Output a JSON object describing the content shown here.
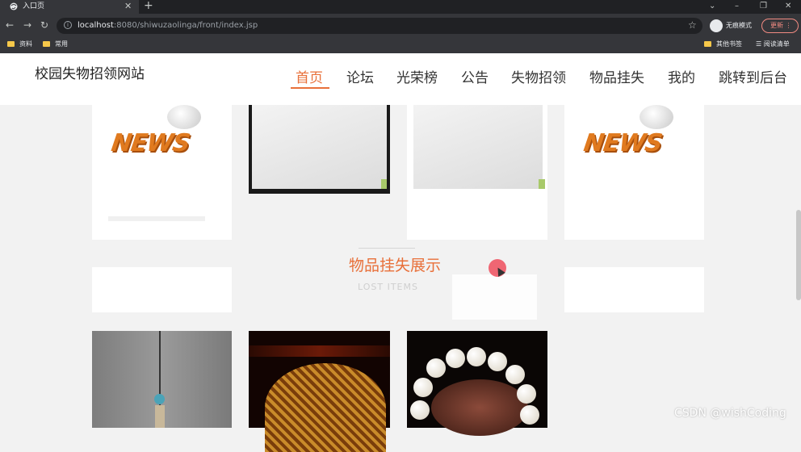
{
  "browser": {
    "tab_title": "入口页",
    "url_host": "localhost",
    "url_rest": ":8080/shiwuzaolinga/front/index.jsp",
    "incognito_label": "无痕模式",
    "update_label": "更新",
    "bookmarks": [
      "资料",
      "常用"
    ],
    "right_bookmarks": [
      "其他书签",
      "阅读清单"
    ]
  },
  "site": {
    "title": "校园失物招领网站",
    "nav": [
      "首页",
      "论坛",
      "光荣榜",
      "公告",
      "失物招领",
      "物品挂失",
      "我的",
      "跳转到后台"
    ],
    "active_nav_index": 0,
    "accent_color": "#e8703a"
  },
  "section": {
    "title": "物品挂失展示",
    "subtitle": "LOST ITEMS"
  },
  "cards_top": [
    {
      "image": "news-globe"
    },
    {
      "image": "laptop"
    },
    {
      "image": "laptop"
    },
    {
      "image": "news-globe"
    }
  ],
  "cards_bottom": [
    {
      "image": "hanging-ornament"
    },
    {
      "image": "woven-bamboo"
    },
    {
      "image": "bead-bracelet"
    }
  ],
  "news_text": "NEWS",
  "watermark": "CSDN @wishCoding"
}
